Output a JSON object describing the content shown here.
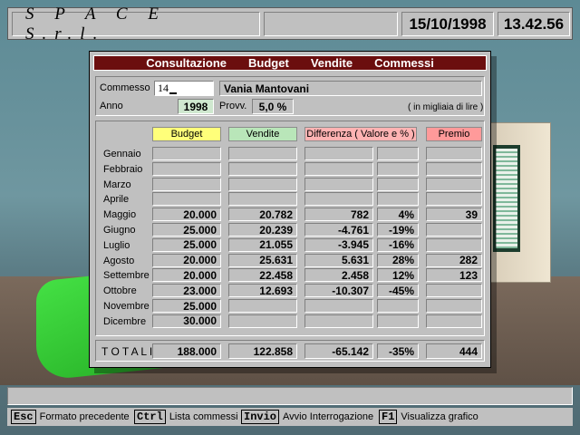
{
  "topbar": {
    "company": "S P A C E   S.r.l.",
    "date": "15/10/1998",
    "time": "13.42.56"
  },
  "window": {
    "menu": [
      "Consultazione",
      "Budget",
      "Vendite",
      "Commessi"
    ],
    "commesso_label": "Commesso",
    "commesso_value": "14",
    "commesso_name": "Vania Mantovani",
    "anno_label": "Anno",
    "anno_value": "1998",
    "provv_label": "Provv.",
    "provv_value": "5,0 %",
    "note": "( in migliaia di lire )",
    "columns": {
      "budget": "Budget",
      "vendite": "Vendite",
      "differenza": "Differenza ( Valore e % )",
      "premio": "Premio"
    },
    "column_colors": {
      "budget": "#ffff7a",
      "vendite": "#b9e6b9",
      "differenza": "#ffb3b3",
      "premio": "#ff9a9a"
    },
    "months": [
      {
        "name": "Gennaio",
        "budget": "",
        "vendite": "",
        "diff": "",
        "perc": "",
        "premio": ""
      },
      {
        "name": "Febbraio",
        "budget": "",
        "vendite": "",
        "diff": "",
        "perc": "",
        "premio": ""
      },
      {
        "name": "Marzo",
        "budget": "",
        "vendite": "",
        "diff": "",
        "perc": "",
        "premio": ""
      },
      {
        "name": "Aprile",
        "budget": "",
        "vendite": "",
        "diff": "",
        "perc": "",
        "premio": ""
      },
      {
        "name": "Maggio",
        "budget": "20.000",
        "vendite": "20.782",
        "diff": "782",
        "perc": "4%",
        "premio": "39"
      },
      {
        "name": "Giugno",
        "budget": "25.000",
        "vendite": "20.239",
        "diff": "-4.761",
        "perc": "-19%",
        "premio": ""
      },
      {
        "name": "Luglio",
        "budget": "25.000",
        "vendite": "21.055",
        "diff": "-3.945",
        "perc": "-16%",
        "premio": ""
      },
      {
        "name": "Agosto",
        "budget": "20.000",
        "vendite": "25.631",
        "diff": "5.631",
        "perc": "28%",
        "premio": "282"
      },
      {
        "name": "Settembre",
        "budget": "20.000",
        "vendite": "22.458",
        "diff": "2.458",
        "perc": "12%",
        "premio": "123"
      },
      {
        "name": "Ottobre",
        "budget": "23.000",
        "vendite": "12.693",
        "diff": "-10.307",
        "perc": "-45%",
        "premio": ""
      },
      {
        "name": "Novembre",
        "budget": "25.000",
        "vendite": "",
        "diff": "",
        "perc": "",
        "premio": ""
      },
      {
        "name": "Dicembre",
        "budget": "30.000",
        "vendite": "",
        "diff": "",
        "perc": "",
        "premio": ""
      }
    ],
    "totals": {
      "label": "T O T A L I",
      "budget": "188.000",
      "vendite": "122.858",
      "diff": "-65.142",
      "perc": "-35%",
      "premio": "444"
    }
  },
  "keys": [
    {
      "key": "Esc",
      "label": "Formato precedente"
    },
    {
      "key": "Ctrl",
      "label": "Lista commessi"
    },
    {
      "key": "Invio",
      "label": "Avvio Interrogazione"
    },
    {
      "key": "F1",
      "label": "Visualizza grafico"
    }
  ]
}
